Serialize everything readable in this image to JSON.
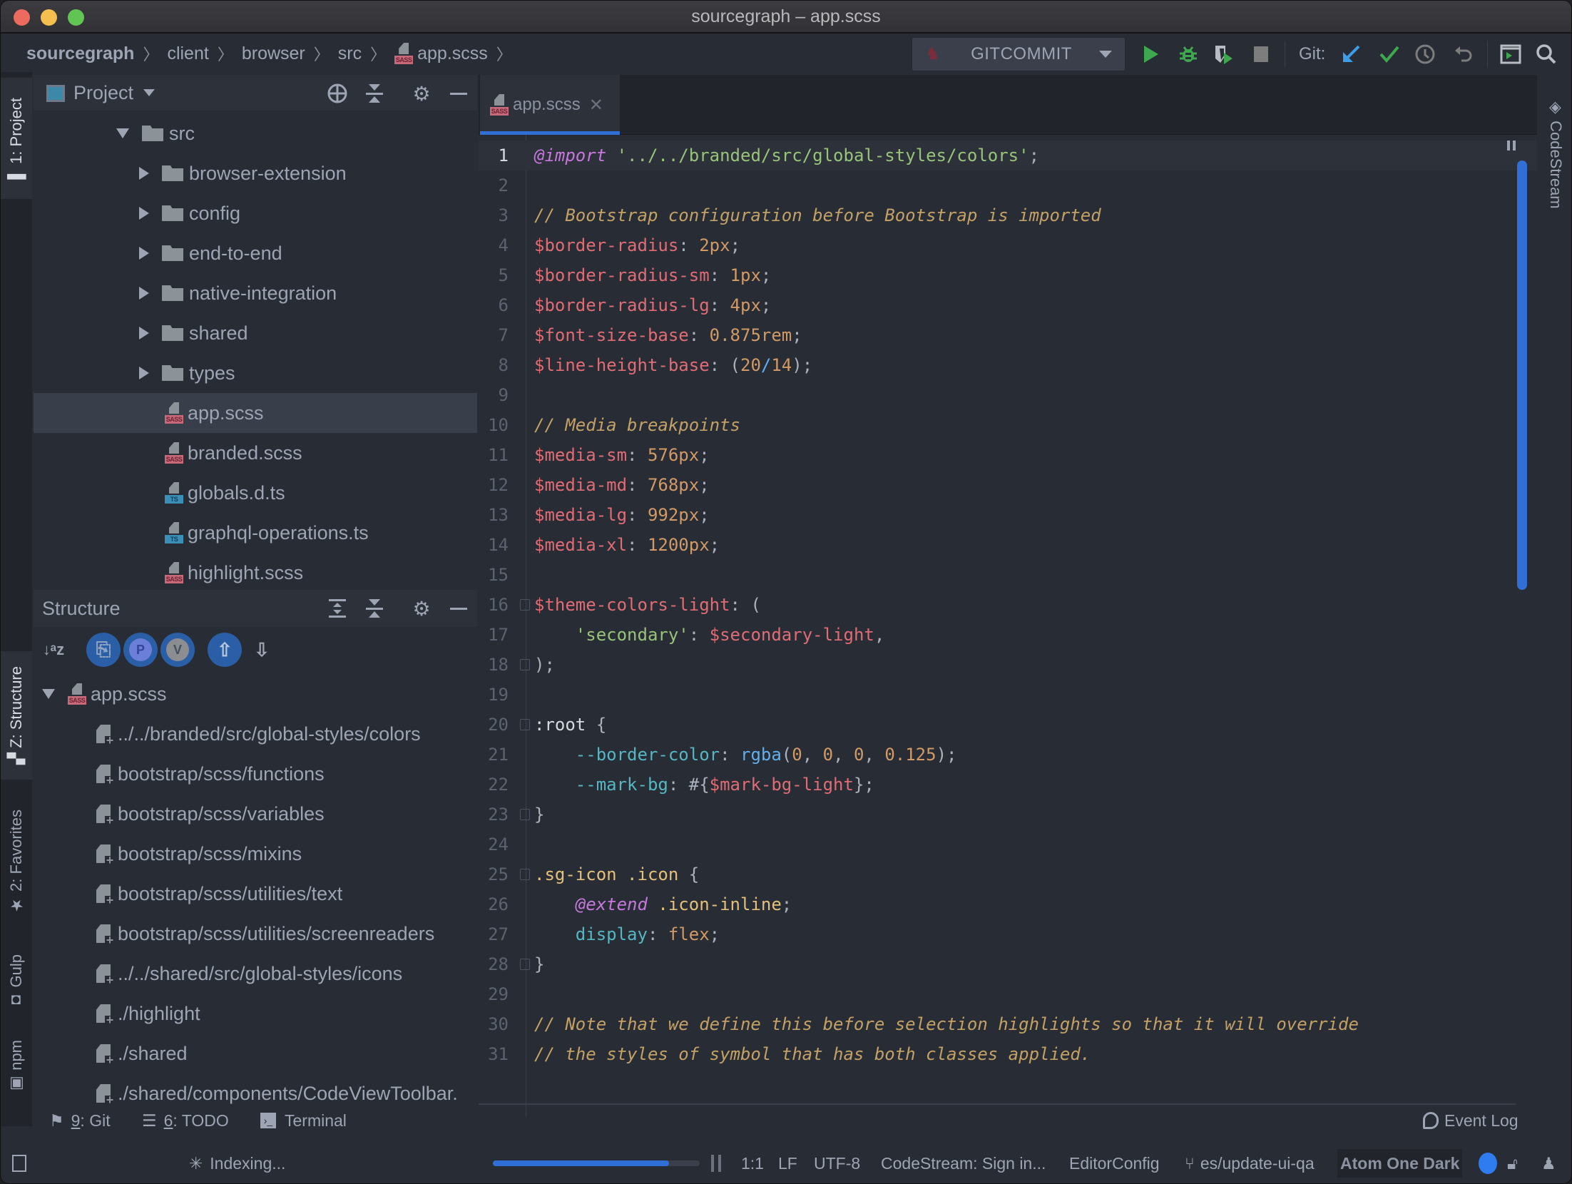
{
  "window": {
    "title": "sourcegraph – app.scss"
  },
  "breadcrumb": {
    "items": [
      "sourcegraph",
      "client",
      "browser",
      "src",
      "app.scss"
    ]
  },
  "toolbar": {
    "run_config": "GITCOMMIT",
    "git_label": "Git:",
    "icons": [
      "run-icon",
      "debug-icon",
      "coverage-icon",
      "stop-icon",
      "git-update-icon",
      "git-commit-icon",
      "git-history-icon",
      "git-rollback-icon",
      "run-anything-icon",
      "search-icon"
    ]
  },
  "colors": {
    "accent": "#2f6fd6",
    "run_green": "#3ea84f",
    "git_blue": "#3d9ee8",
    "sass_badge": "#c66a7a",
    "ts_badge": "#3a8fb7"
  },
  "left_stripe": {
    "tabs": [
      "1: Project",
      "Z: Structure",
      "2: Favorites",
      "Gulp",
      "npm"
    ]
  },
  "right_stripe": {
    "tabs": [
      "CodeStream"
    ]
  },
  "project": {
    "title": "Project",
    "tree": [
      {
        "label": "src",
        "type": "folder",
        "expanded": true,
        "depth": 0
      },
      {
        "label": "browser-extension",
        "type": "folder",
        "expanded": false,
        "depth": 1
      },
      {
        "label": "config",
        "type": "folder",
        "expanded": false,
        "depth": 1
      },
      {
        "label": "end-to-end",
        "type": "folder",
        "expanded": false,
        "depth": 1
      },
      {
        "label": "native-integration",
        "type": "folder",
        "expanded": false,
        "depth": 1
      },
      {
        "label": "shared",
        "type": "folder",
        "expanded": false,
        "depth": 1
      },
      {
        "label": "types",
        "type": "folder",
        "expanded": false,
        "depth": 1
      },
      {
        "label": "app.scss",
        "type": "sass",
        "depth": 1,
        "selected": true
      },
      {
        "label": "branded.scss",
        "type": "sass",
        "depth": 1
      },
      {
        "label": "globals.d.ts",
        "type": "ts",
        "depth": 1
      },
      {
        "label": "graphql-operations.ts",
        "type": "ts",
        "depth": 1
      },
      {
        "label": "highlight.scss",
        "type": "sass",
        "depth": 1
      }
    ]
  },
  "structure": {
    "title": "Structure",
    "toolbar": [
      "sort-alpha-icon",
      "show-imports-icon",
      "show-properties-icon",
      "show-variables-icon",
      "autoscroll-to-source-icon",
      "autoscroll-from-source-icon"
    ],
    "root": "app.scss",
    "items": [
      "../../branded/src/global-styles/colors",
      "bootstrap/scss/functions",
      "bootstrap/scss/variables",
      "bootstrap/scss/mixins",
      "bootstrap/scss/utilities/text",
      "bootstrap/scss/utilities/screenreaders",
      "../../shared/src/global-styles/icons",
      "./highlight",
      "./shared",
      "./shared/components/CodeViewToolbar."
    ]
  },
  "editor": {
    "tab": "app.scss",
    "current_line": 1,
    "lines": [
      [
        [
          "kw",
          "@import"
        ],
        [
          "pun",
          " "
        ],
        [
          "str",
          "'../../branded/src/global-styles/colors'"
        ],
        [
          "pun",
          ";"
        ]
      ],
      [],
      [
        [
          "com",
          "// Bootstrap configuration before Bootstrap is imported"
        ]
      ],
      [
        [
          "var",
          "$border-radius"
        ],
        [
          "pun",
          ": "
        ],
        [
          "num",
          "2px"
        ],
        [
          "pun",
          ";"
        ]
      ],
      [
        [
          "var",
          "$border-radius-sm"
        ],
        [
          "pun",
          ": "
        ],
        [
          "num",
          "1px"
        ],
        [
          "pun",
          ";"
        ]
      ],
      [
        [
          "var",
          "$border-radius-lg"
        ],
        [
          "pun",
          ": "
        ],
        [
          "num",
          "4px"
        ],
        [
          "pun",
          ";"
        ]
      ],
      [
        [
          "var",
          "$font-size-base"
        ],
        [
          "pun",
          ": "
        ],
        [
          "num",
          "0.875rem"
        ],
        [
          "pun",
          ";"
        ]
      ],
      [
        [
          "var",
          "$line-height-base"
        ],
        [
          "pun",
          ": ("
        ],
        [
          "num",
          "20"
        ],
        [
          "fn",
          "/"
        ],
        [
          "num",
          "14"
        ],
        [
          "pun",
          ");"
        ]
      ],
      [],
      [
        [
          "com",
          "// Media breakpoints"
        ]
      ],
      [
        [
          "var",
          "$media-sm"
        ],
        [
          "pun",
          ": "
        ],
        [
          "num",
          "576px"
        ],
        [
          "pun",
          ";"
        ]
      ],
      [
        [
          "var",
          "$media-md"
        ],
        [
          "pun",
          ": "
        ],
        [
          "num",
          "768px"
        ],
        [
          "pun",
          ";"
        ]
      ],
      [
        [
          "var",
          "$media-lg"
        ],
        [
          "pun",
          ": "
        ],
        [
          "num",
          "992px"
        ],
        [
          "pun",
          ";"
        ]
      ],
      [
        [
          "var",
          "$media-xl"
        ],
        [
          "pun",
          ": "
        ],
        [
          "num",
          "1200px"
        ],
        [
          "pun",
          ";"
        ]
      ],
      [],
      [
        [
          "var",
          "$theme-colors-light"
        ],
        [
          "pun",
          ": ("
        ]
      ],
      [
        [
          "pun",
          "    "
        ],
        [
          "str",
          "'secondary'"
        ],
        [
          "pun",
          ": "
        ],
        [
          "var",
          "$secondary-light"
        ],
        [
          "pun",
          ","
        ]
      ],
      [
        [
          "pun",
          ");"
        ]
      ],
      [],
      [
        [
          "root",
          ":root"
        ],
        [
          "pun",
          " {"
        ]
      ],
      [
        [
          "pun",
          "    "
        ],
        [
          "prop",
          "--border-color"
        ],
        [
          "pun",
          ": "
        ],
        [
          "fn",
          "rgba"
        ],
        [
          "pun",
          "("
        ],
        [
          "num",
          "0"
        ],
        [
          "pun",
          ", "
        ],
        [
          "num",
          "0"
        ],
        [
          "pun",
          ", "
        ],
        [
          "num",
          "0"
        ],
        [
          "pun",
          ", "
        ],
        [
          "num",
          "0.125"
        ],
        [
          "pun",
          ");"
        ]
      ],
      [
        [
          "pun",
          "    "
        ],
        [
          "prop",
          "--mark-bg"
        ],
        [
          "pun",
          ": #{"
        ],
        [
          "var",
          "$mark-bg-light"
        ],
        [
          "pun",
          "};"
        ]
      ],
      [
        [
          "pun",
          "}"
        ]
      ],
      [],
      [
        [
          "sel",
          ".sg-icon .icon"
        ],
        [
          "pun",
          " {"
        ]
      ],
      [
        [
          "pun",
          "    "
        ],
        [
          "kw",
          "@extend"
        ],
        [
          "pun",
          " "
        ],
        [
          "sel",
          ".icon-inline"
        ],
        [
          "pun",
          ";"
        ]
      ],
      [
        [
          "pun",
          "    "
        ],
        [
          "prop",
          "display"
        ],
        [
          "pun",
          ": "
        ],
        [
          "num",
          "flex"
        ],
        [
          "pun",
          ";"
        ]
      ],
      [
        [
          "pun",
          "}"
        ]
      ],
      [],
      [
        [
          "com",
          "// Note that we define this before selection highlights so that it will override"
        ]
      ],
      [
        [
          "com",
          "// the styles of symbol that has both classes applied."
        ]
      ]
    ],
    "fold_lines": [
      16,
      18,
      20,
      23,
      25,
      28
    ]
  },
  "tool_windows": [
    {
      "key": "9",
      "label": ": Git"
    },
    {
      "key": "6",
      "label": ": TODO"
    },
    {
      "key": "",
      "label": "Terminal"
    }
  ],
  "event_log": "Event Log",
  "status_bar": {
    "indexing": "Indexing...",
    "indexing_progress": 0.85,
    "position": "1:1",
    "line_sep": "LF",
    "encoding": "UTF-8",
    "codestream": "CodeStream: Sign in...",
    "editorconfig": "EditorConfig",
    "branch": "es/update-ui-qa",
    "theme": "Atom One Dark"
  }
}
